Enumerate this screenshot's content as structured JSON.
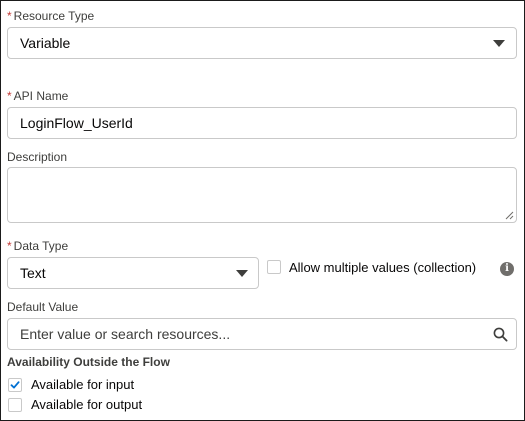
{
  "resource_type": {
    "required_mark": "*",
    "label": "Resource Type",
    "value": "Variable"
  },
  "api_name": {
    "required_mark": "*",
    "label": "API Name",
    "value": "LoginFlow_UserId"
  },
  "description": {
    "label": "Description",
    "value": ""
  },
  "data_type": {
    "required_mark": "*",
    "label": "Data Type",
    "value": "Text"
  },
  "allow_multiple": {
    "label": "Allow multiple values (collection)",
    "checked": false
  },
  "default_value": {
    "label": "Default Value",
    "placeholder": "Enter value or search resources..."
  },
  "availability": {
    "heading": "Availability Outside the Flow",
    "input_label": "Available for input",
    "input_checked": true,
    "output_label": "Available for output",
    "output_checked": false
  },
  "colors": {
    "required": "#c23934",
    "check": "#0070d2",
    "border": "#c9c9c9"
  }
}
